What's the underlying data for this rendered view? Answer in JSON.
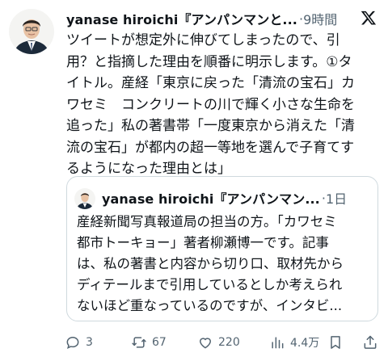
{
  "tweet": {
    "author": "yanase hiroichi『アンパンマンと...",
    "separator": "·",
    "time": "9時間",
    "lines": [
      "ツイートが想定外に伸びてしまったので、引",
      "用？と指摘した理由を順番に明示します。①タ",
      "イトル。産経「東京に戻った「清流の宝石」カ",
      "ワセミ　コンクリートの川で輝く小さな生命を",
      "追った」私の著書帯「一度東京から消えた「清",
      "流の宝石」が都内の超一等地を選んで子育てす",
      "るようになった理由とは」"
    ]
  },
  "quoted": {
    "author": "yanase hiroichi『アンパンマン...",
    "separator": "·",
    "time": "1日",
    "lines": [
      "産経新聞写真報道局の担当の方。「カワセミ",
      "都市トーキョー」著者柳瀬博一です。記事",
      "は、私の著書と内容から切り口、取材先から",
      "ディテールまで引用しているとしか考えられ",
      "ないほど重なっているのですが、インタビ..."
    ]
  },
  "actions": {
    "replies": "3",
    "reposts": "67",
    "likes": "220",
    "views": "4.4万"
  },
  "colors": {
    "text": "#0f1419",
    "muted": "#536471",
    "border": "#cfd9de"
  },
  "icons": [
    "x-logo-icon",
    "reply-icon",
    "repost-icon",
    "like-icon",
    "views-icon",
    "bookmark-icon",
    "share-icon"
  ]
}
